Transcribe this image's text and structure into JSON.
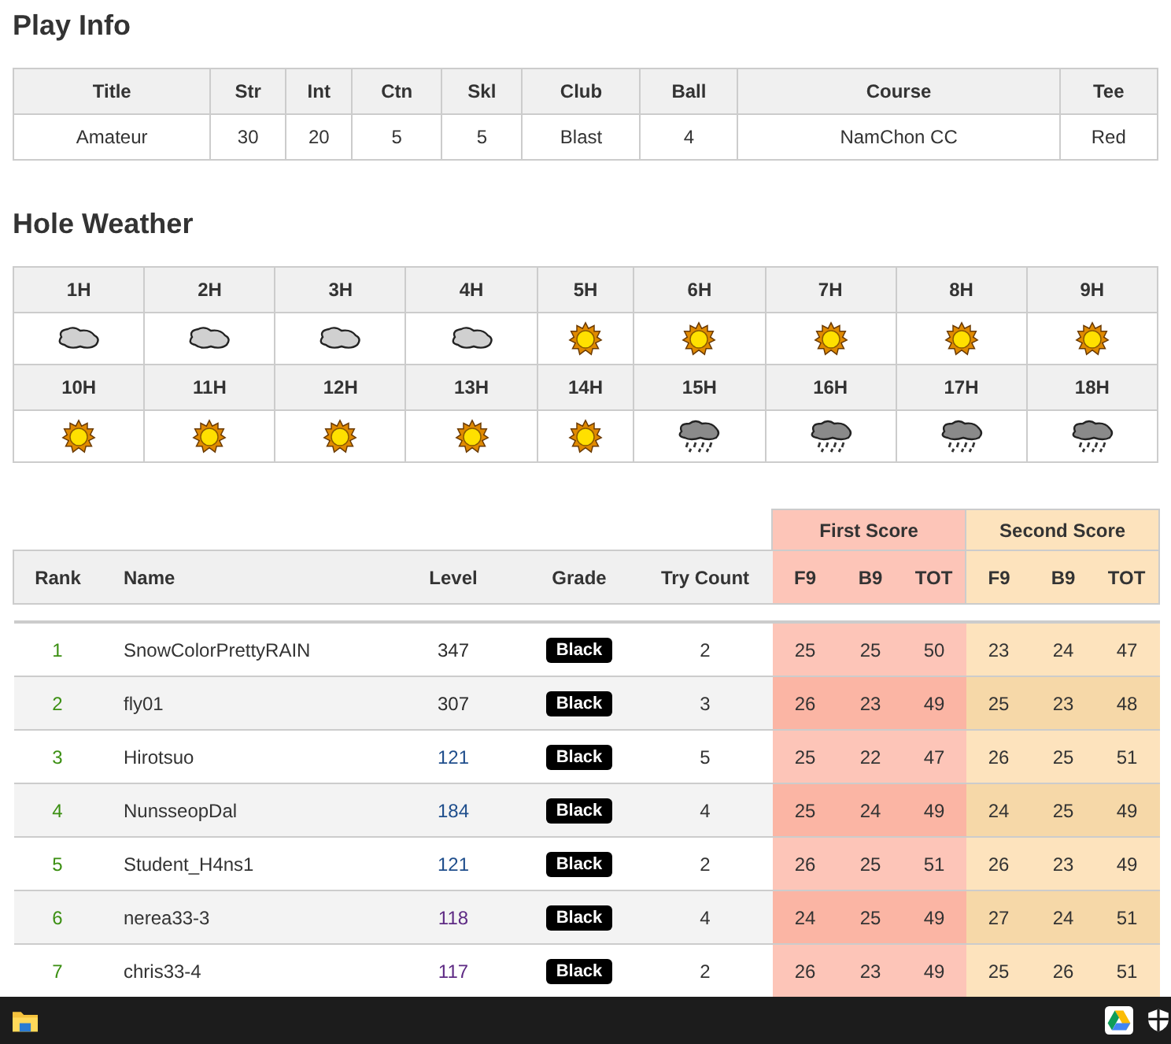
{
  "play_info": {
    "title": "Play Info",
    "columns": [
      "Title",
      "Str",
      "Int",
      "Ctn",
      "Skl",
      "Club",
      "Ball",
      "Course",
      "Tee"
    ],
    "row": [
      "Amateur",
      "30",
      "20",
      "5",
      "5",
      "Blast",
      "4",
      "NamChon CC",
      "Red"
    ]
  },
  "hole_weather": {
    "title": "Hole Weather",
    "rows": [
      [
        {
          "label": "1H",
          "kind": "cloudy"
        },
        {
          "label": "2H",
          "kind": "cloudy"
        },
        {
          "label": "3H",
          "kind": "cloudy"
        },
        {
          "label": "4H",
          "kind": "cloudy"
        },
        {
          "label": "5H",
          "kind": "sunny"
        },
        {
          "label": "6H",
          "kind": "sunny"
        },
        {
          "label": "7H",
          "kind": "sunny"
        },
        {
          "label": "8H",
          "kind": "sunny"
        },
        {
          "label": "9H",
          "kind": "sunny"
        }
      ],
      [
        {
          "label": "10H",
          "kind": "sunny"
        },
        {
          "label": "11H",
          "kind": "sunny"
        },
        {
          "label": "12H",
          "kind": "sunny"
        },
        {
          "label": "13H",
          "kind": "sunny"
        },
        {
          "label": "14H",
          "kind": "sunny"
        },
        {
          "label": "15H",
          "kind": "rain"
        },
        {
          "label": "16H",
          "kind": "rain"
        },
        {
          "label": "17H",
          "kind": "rain"
        },
        {
          "label": "18H",
          "kind": "rain"
        }
      ]
    ]
  },
  "scores": {
    "groups": [
      "First Score",
      "Second Score"
    ],
    "columns": [
      "Rank",
      "Name",
      "Level",
      "Grade",
      "Try Count"
    ],
    "sub_columns": [
      "F9",
      "B9",
      "TOT",
      "F9",
      "B9",
      "TOT"
    ],
    "rows": [
      {
        "rank": "1",
        "name": "SnowColorPrettyRAIN",
        "level": "347",
        "color": "#2b2b2b",
        "grade": "Black",
        "try_count": "2",
        "first": [
          "25",
          "25",
          "50"
        ],
        "second": [
          "23",
          "24",
          "47"
        ]
      },
      {
        "rank": "2",
        "name": "fly01",
        "level": "307",
        "color": "#2b2b2b",
        "grade": "Black",
        "try_count": "3",
        "first": [
          "26",
          "23",
          "49"
        ],
        "second": [
          "25",
          "23",
          "48"
        ]
      },
      {
        "rank": "3",
        "name": "Hirotsuo",
        "level": "121",
        "color": "#1f4e8c",
        "grade": "Black",
        "try_count": "5",
        "first": [
          "25",
          "22",
          "47"
        ],
        "second": [
          "26",
          "25",
          "51"
        ]
      },
      {
        "rank": "4",
        "name": "NunsseopDal",
        "level": "184",
        "color": "#1f4e8c",
        "grade": "Black",
        "try_count": "4",
        "first": [
          "25",
          "24",
          "49"
        ],
        "second": [
          "24",
          "25",
          "49"
        ]
      },
      {
        "rank": "5",
        "name": "Student_H4ns1",
        "level": "121",
        "color": "#1f4e8c",
        "grade": "Black",
        "try_count": "2",
        "first": [
          "26",
          "25",
          "51"
        ],
        "second": [
          "26",
          "23",
          "49"
        ]
      },
      {
        "rank": "6",
        "name": "nerea33-3",
        "level": "118",
        "color": "#5e2a84",
        "grade": "Black",
        "try_count": "4",
        "first": [
          "24",
          "25",
          "49"
        ],
        "second": [
          "27",
          "24",
          "51"
        ]
      },
      {
        "rank": "7",
        "name": "chris33-4",
        "level": "117",
        "color": "#5e2a84",
        "grade": "Black",
        "try_count": "2",
        "first": [
          "26",
          "23",
          "49"
        ],
        "second": [
          "25",
          "26",
          "51"
        ]
      }
    ]
  }
}
